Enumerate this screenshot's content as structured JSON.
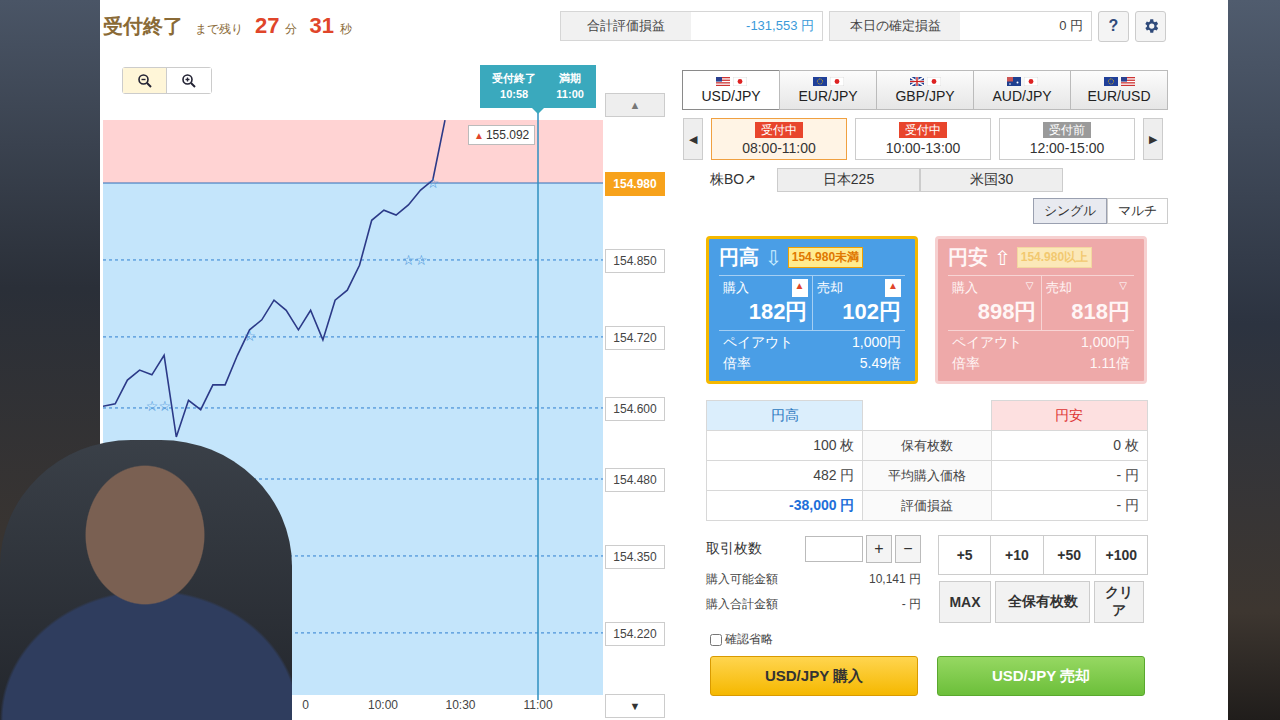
{
  "countdown": {
    "title": "受付終了",
    "prefix": "まで残り",
    "minutes": "27",
    "min_unit": "分",
    "seconds": "31",
    "sec_unit": "秒"
  },
  "summary": [
    {
      "label": "合計評価損益",
      "value": "-131,553 円",
      "negative": true
    },
    {
      "label": "本日の確定損益",
      "value": "0 円",
      "negative": false
    }
  ],
  "help_button": "?",
  "chart": {
    "threshold": "154.980",
    "y_ticks": [
      "154.980",
      "154.850",
      "154.720",
      "154.600",
      "154.480",
      "154.350",
      "154.220"
    ],
    "x_ticks": [
      "0",
      "10:00",
      "10:30",
      "11:00"
    ],
    "close_badge": {
      "label": "受付終了",
      "time": "10:58"
    },
    "expiry_badge": {
      "label": "満期",
      "time": "11:00"
    },
    "last": {
      "glyph": "▲",
      "price": "155.092"
    },
    "series": [
      154.603,
      154.607,
      154.647,
      154.664,
      154.656,
      154.689,
      154.551,
      154.613,
      154.597,
      154.639,
      154.639,
      154.689,
      154.732,
      154.749,
      154.782,
      154.765,
      154.732,
      154.765,
      154.715,
      154.782,
      154.799,
      154.841,
      154.917,
      154.934,
      154.926,
      154.943,
      154.968,
      154.985,
      155.086
    ],
    "markers": [
      {
        "glyph": "☆",
        "index": 1,
        "price": 154.485
      },
      {
        "glyph": "☆☆",
        "index": 4,
        "price": 154.603
      },
      {
        "glyph": "☆",
        "index": 12,
        "price": 154.722
      },
      {
        "glyph": "☆☆",
        "index": 25,
        "price": 154.85
      },
      {
        "glyph": "☆",
        "index": 27,
        "price": 154.98
      }
    ],
    "scroll_up": "▲",
    "scroll_down": "▼"
  },
  "pairs": [
    {
      "label": "USD/JPY",
      "selected": true
    },
    {
      "label": "EUR/JPY",
      "selected": false
    },
    {
      "label": "GBP/JPY",
      "selected": false
    },
    {
      "label": "AUD/JPY",
      "selected": false
    },
    {
      "label": "EUR/USD",
      "selected": false
    }
  ],
  "sessions": {
    "prev": "◀",
    "next": "▶",
    "items": [
      {
        "status": "受付中",
        "open": true,
        "time": "08:00-11:00",
        "selected": true
      },
      {
        "status": "受付中",
        "open": true,
        "time": "10:00-13:00",
        "selected": false
      },
      {
        "status": "受付前",
        "open": false,
        "time": "12:00-15:00",
        "selected": false
      }
    ]
  },
  "stock_bo": {
    "label": "株BO↗",
    "items": [
      "日本225",
      "米国30"
    ]
  },
  "modes": [
    {
      "label": "シングル",
      "selected": true
    },
    {
      "label": "マルチ",
      "selected": false
    }
  ],
  "options": [
    {
      "label": "円高",
      "arrow": "⇩",
      "strike": "154.980未満",
      "side": "up",
      "selected": true,
      "disabled": false,
      "buy_label": "購入",
      "buy_glyph": "▲",
      "buy": "182円",
      "sell_label": "売却",
      "sell_glyph": "▲",
      "sell": "102円",
      "payout_label": "ペイアウト",
      "payout": "1,000円",
      "ratio_label": "倍率",
      "ratio": "5.49倍"
    },
    {
      "label": "円安",
      "arrow": "⇧",
      "strike": "154.980以上",
      "side": "down",
      "selected": false,
      "disabled": true,
      "buy_label": "購入",
      "buy_glyph": "▽",
      "buy": "898円",
      "sell_label": "売却",
      "sell_glyph": "▽",
      "sell": "818円",
      "payout_label": "ペイアウト",
      "payout": "1,000円",
      "ratio_label": "倍率",
      "ratio": "1.11倍"
    }
  ],
  "holdings": {
    "up_header": "円高",
    "down_header": "円安",
    "rows": [
      {
        "up": "100 枚",
        "label": "保有枚数",
        "down": "0 枚",
        "up_negative": false
      },
      {
        "up": "482 円",
        "label": "平均購入価格",
        "down": "- 円",
        "up_negative": false
      },
      {
        "up": "-38,000 円",
        "label": "評価損益",
        "down": "- 円",
        "up_negative": true
      }
    ]
  },
  "order": {
    "label": "取引枚数",
    "quantity": "",
    "plus": "+",
    "minus": "−",
    "presets": [
      "+5",
      "+10",
      "+50",
      "+100"
    ],
    "available_label": "購入可能金額",
    "available": "10,141 円",
    "total_label": "購入合計金額",
    "total": "- 円",
    "actions": [
      "MAX",
      "全保有枚数",
      "クリア"
    ],
    "skip_confirm": {
      "label": "確認省略",
      "checked": false
    }
  },
  "submit": [
    {
      "label": "USD/JPY 購入",
      "kind": "buy"
    },
    {
      "label": "USD/JPY 売却",
      "kind": "sell"
    }
  ]
}
